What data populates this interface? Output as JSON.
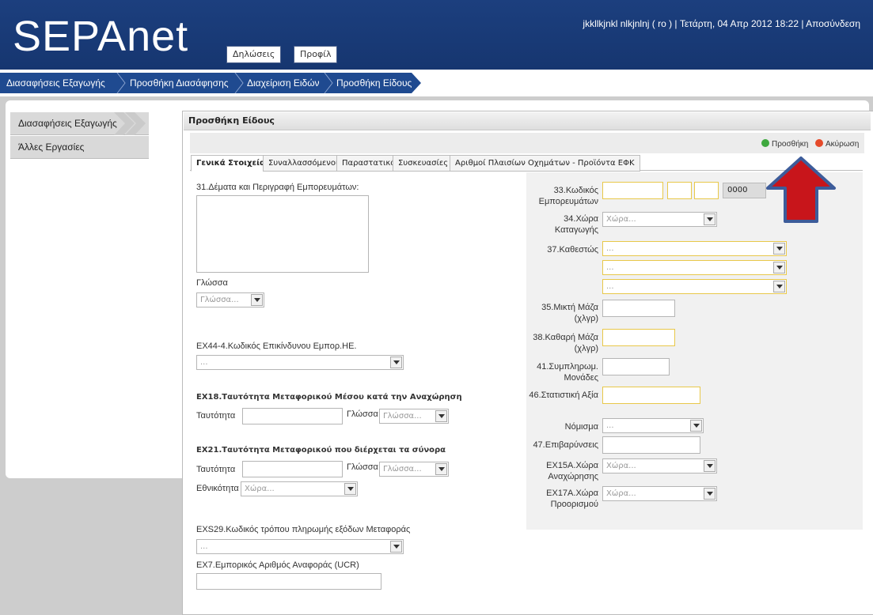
{
  "header": {
    "logo": "SEPAnet",
    "nav_declarations": "Δηλώσεις",
    "nav_profile": "Προφίλ",
    "user_info": "jkkllkjnkl nlkjnlnj ( ro ) | Τετάρτη, 04 Απρ 2012 18:22 | Αποσύνδεση"
  },
  "breadcrumb": [
    "Διασαφήσεις Εξαγωγής",
    "Προσθήκη Διασάφησης",
    "Διαχείριση Ειδών",
    "Προσθήκη Είδους"
  ],
  "sidebar": {
    "items": [
      {
        "label": "Διασαφήσεις Εξαγωγής"
      },
      {
        "label": "Άλλες Εργασίες"
      }
    ]
  },
  "panel": {
    "title": "Προσθήκη Είδους",
    "add_label": "Προσθήκη",
    "cancel_label": "Ακύρωση"
  },
  "tabs": [
    {
      "label": "Γενικά Στοιχεία"
    },
    {
      "label": "Συναλλασσόμενοι"
    },
    {
      "label": "Παραστατικά"
    },
    {
      "label": "Συσκευασίες"
    },
    {
      "label": "Αριθμοί Πλαισίων Οχημάτων - Προϊόντα ΕΦΚ"
    }
  ],
  "left_form": {
    "description_label": "31.Δέματα και Περιγραφή Εμπορευμάτων:",
    "language_label": "Γλώσσα",
    "language_placeholder": "Γλώσσα...",
    "dangerous_code_label": "ΕΧ44-4.Κωδικός Επικίνδυνου Εμπορ.ΗΕ.",
    "dangerous_code_placeholder": "...",
    "ex18_title": "ΕΧ18.Ταυτότητα Μεταφορικού Μέσου κατά την Αναχώρηση",
    "ex18_identity_label": "Ταυτότητα",
    "ex18_language_label": "Γλώσσα",
    "ex18_language_placeholder": "Γλώσσα...",
    "ex21_title": "ΕΧ21.Ταυτότητα Μεταφορικού που διέρχεται τα σύνορα",
    "ex21_identity_label": "Ταυτότητα",
    "ex21_language_label": "Γλώσσα",
    "ex21_language_placeholder": "Γλώσσα...",
    "ex21_nationality_label": "Εθνικότητα",
    "ex21_nationality_placeholder": "Χώρα...",
    "exs29_label": "EXS29.Κωδικός τρόπου πληρωμής εξόδων Μεταφοράς",
    "exs29_placeholder": "...",
    "ex7_label": "ΕΧ7.Εμπορικός Αριθμός Αναφοράς (UCR)"
  },
  "right_form": {
    "goods_code_label": "33.Κωδικός Εμπορευμάτων",
    "goods_code_suffix": "0000",
    "origin_country_label": "34.Χώρα Καταγωγής",
    "origin_country_placeholder": "Χώρα...",
    "regime_label": "37.Καθεστώς",
    "regime_placeholder": "...",
    "gross_mass_label": "35.Μικτή Μάζα (χλγρ)",
    "net_mass_label": "38.Καθαρή Μάζα (χλγρ)",
    "supplementary_units_label": "41.Συμπληρωμ. Μονάδες",
    "statistical_value_label": "46.Στατιστική Αξία",
    "currency_label": "Νόμισμα",
    "currency_placeholder": "...",
    "charges_label": "47.Επιβαρύνσεις",
    "ex15a_label": "ΕΧ15Α.Χώρα Αναχώρησης",
    "ex15a_placeholder": "Χώρα...",
    "ex17a_label": "ΕΧ17Α.Χώρα Προορισμού",
    "ex17a_placeholder": "Χώρα..."
  },
  "colors": {
    "header_blue": "#1c3f7e",
    "crumb_blue": "#1f4a90",
    "required_border": "#e8c84a",
    "annotation_arrow": "#c8151b"
  }
}
